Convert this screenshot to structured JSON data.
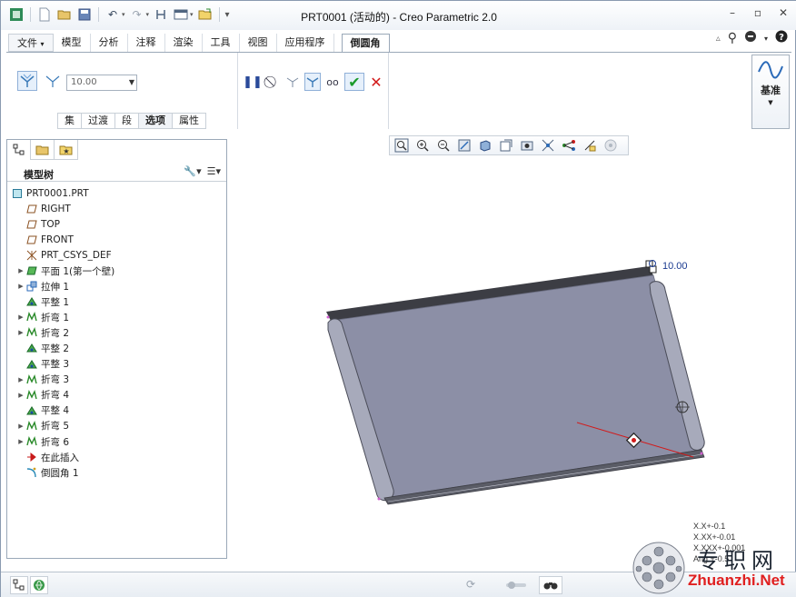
{
  "window": {
    "title": "PRT0001 (活动的) - Creo Parametric 2.0"
  },
  "menu_tabs": [
    "文件",
    "模型",
    "分析",
    "注释",
    "渲染",
    "工具",
    "视图",
    "应用程序"
  ],
  "active_tab": "倒圆角",
  "file_tab_arrow": "▾",
  "ribbon": {
    "radius_value": "10.00",
    "sub_tabs": [
      "集",
      "过渡",
      "段",
      "选项",
      "属性"
    ],
    "active_sub_tab": "选项",
    "datum_label": "基准"
  },
  "model_tree": {
    "title": "模型树",
    "items": [
      {
        "label": "PRT0001.PRT",
        "icon": "part-icon",
        "expandable": false,
        "indent": 0
      },
      {
        "label": "RIGHT",
        "icon": "datum-plane-icon",
        "expandable": false,
        "indent": 1
      },
      {
        "label": "TOP",
        "icon": "datum-plane-icon",
        "expandable": false,
        "indent": 1
      },
      {
        "label": "FRONT",
        "icon": "datum-plane-icon",
        "expandable": false,
        "indent": 1
      },
      {
        "label": "PRT_CSYS_DEF",
        "icon": "csys-icon",
        "expandable": false,
        "indent": 1
      },
      {
        "label": "平面 1(第一个壁)",
        "icon": "flat-wall-icon",
        "expandable": true,
        "indent": 1
      },
      {
        "label": "拉伸 1",
        "icon": "extrude-icon",
        "expandable": true,
        "indent": 1
      },
      {
        "label": "平整 1",
        "icon": "unbend-icon",
        "expandable": false,
        "indent": 1
      },
      {
        "label": "折弯 1",
        "icon": "bend-icon",
        "expandable": true,
        "indent": 1
      },
      {
        "label": "折弯 2",
        "icon": "bend-icon",
        "expandable": true,
        "indent": 1
      },
      {
        "label": "平整 2",
        "icon": "unbend-icon",
        "expandable": false,
        "indent": 1
      },
      {
        "label": "平整 3",
        "icon": "unbend-icon",
        "expandable": false,
        "indent": 1
      },
      {
        "label": "折弯 3",
        "icon": "bend-icon",
        "expandable": true,
        "indent": 1
      },
      {
        "label": "折弯 4",
        "icon": "bend-icon",
        "expandable": true,
        "indent": 1
      },
      {
        "label": "平整 4",
        "icon": "unbend-icon",
        "expandable": false,
        "indent": 1
      },
      {
        "label": "折弯 5",
        "icon": "bend-icon",
        "expandable": true,
        "indent": 1
      },
      {
        "label": "折弯 6",
        "icon": "bend-icon",
        "expandable": true,
        "indent": 1
      },
      {
        "label": "在此插入",
        "icon": "insert-here-icon",
        "expandable": false,
        "indent": 1
      },
      {
        "label": "倒圆角 1",
        "icon": "round-icon",
        "expandable": false,
        "indent": 1
      }
    ]
  },
  "canvas": {
    "dimension_label": "10.00",
    "tolerances": [
      "X.X+-0.1",
      "X.XX+-0.01",
      "X.XXX+-0.001",
      "Ang.+-0.5"
    ]
  },
  "watermark": {
    "cn": "专职网",
    "en": "Zhuanzhi.Net"
  },
  "colors": {
    "model_face": "#8c8fa6",
    "model_edge": "#3c3d44",
    "accent_red": "#d21a1a",
    "ok_green": "#1a9a2a",
    "dimension_blue": "#1a3a90"
  }
}
